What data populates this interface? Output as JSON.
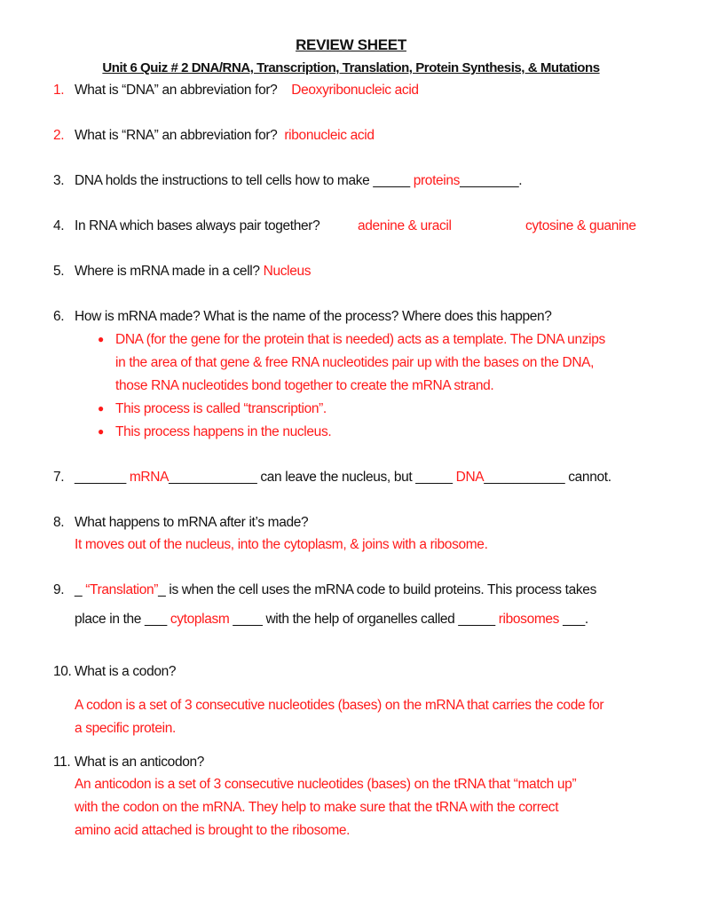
{
  "title": "REVIEW SHEET",
  "subtitle": "Unit 6 Quiz # 2 DNA/RNA, Transcription, Translation, Protein Synthesis, & Mutations",
  "q1": {
    "num": "1.",
    "text": "What is “DNA” an abbreviation for?",
    "answer": "Deoxyribonucleic acid"
  },
  "q2": {
    "num": "2.",
    "text": "What is “RNA” an abbreviation for?",
    "answer": "ribonucleic acid"
  },
  "q3": {
    "num": "3.",
    "text_before": "DNA holds the instructions to tell cells how to make _____",
    "answer": "proteins",
    "text_after": "________."
  },
  "q4": {
    "num": "4.",
    "text": "In RNA which bases always pair together?",
    "answer1": "adenine & uracil",
    "answer2": "cytosine & guanine"
  },
  "q5": {
    "num": "5.",
    "text": "Where is mRNA made in a cell?",
    "answer": "Nucleus"
  },
  "q6": {
    "num": "6.",
    "text": "How is mRNA made? What is the name of the process? Where does this happen?",
    "bullet_glyph": "●",
    "bullets": [
      {
        "lines": [
          "DNA (for the gene for the protein that is needed) acts as a template. The DNA unzips",
          "in the area of that gene & free RNA nucleotides pair up with the bases on the DNA,",
          "those RNA nucleotides bond together to create the mRNA strand."
        ]
      },
      {
        "lines": [
          "This process is called “transcription”."
        ]
      },
      {
        "lines": [
          "This process happens in the nucleus."
        ]
      }
    ]
  },
  "q7": {
    "num": "7.",
    "blank1": "_______",
    "answer1": "mRNA",
    "blank2": "____________",
    "text_mid": "can leave the nucleus, but _____",
    "answer2": "DNA",
    "blank3": "___________",
    "text_end": "cannot."
  },
  "q8": {
    "num": "8.",
    "text": "What happens to mRNA after it’s made?",
    "answer": "It moves out of the nucleus, into the cytoplasm, & joins with a ribosome."
  },
  "q9": {
    "num": "9.",
    "line1_pre": "_",
    "answer1": "“Translation”",
    "line1_post": "_ is when the cell uses the mRNA code to build proteins. This process takes",
    "line2_pre": "place in the ___",
    "answer2": "cytoplasm",
    "line2_mid": "____ with the help of organelles called _____",
    "answer3": "ribosomes",
    "line2_post": "___."
  },
  "q10": {
    "num": "10.",
    "text": "What is a codon?",
    "answer_lines": [
      "A codon is a set of 3 consecutive nucleotides (bases) on the mRNA that carries the code for",
      "a specific protein."
    ]
  },
  "q11": {
    "num": "11.",
    "text": "What is an anticodon?",
    "answer_lines": [
      "An anticodon is a set of 3 consecutive nucleotides (bases) on the tRNA that “match up”",
      "with the codon on the mRNA. They help to make sure that the tRNA with the correct",
      "amino acid attached is brought to the ribosome."
    ]
  }
}
